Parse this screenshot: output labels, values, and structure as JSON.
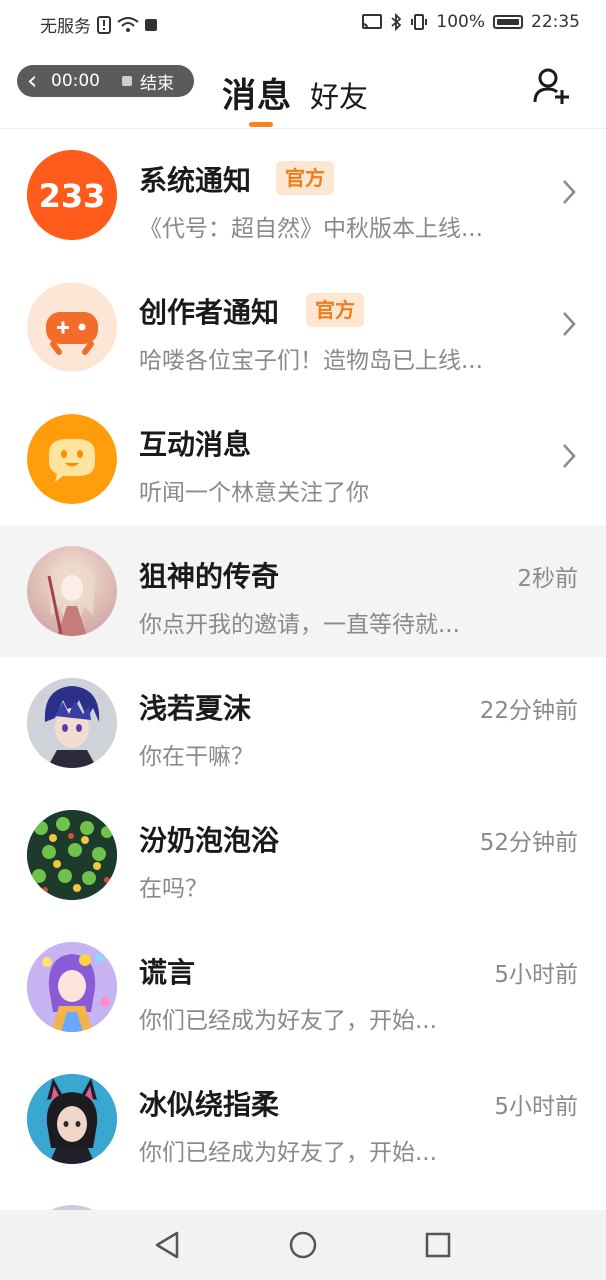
{
  "status_bar": {
    "carrier": "无服务",
    "battery": "100%",
    "time": "22:35"
  },
  "recorder": {
    "time": "00:00",
    "end_label": "结束"
  },
  "header": {
    "tabs": [
      {
        "label": "消息",
        "active": true
      },
      {
        "label": "好友",
        "active": false
      }
    ],
    "accent_color": "#f5821f"
  },
  "notifications": [
    {
      "name": "系统通知",
      "badge": "官方",
      "preview": "《代号：超自然》中秋版本上线...",
      "icon": "logo-233-icon"
    },
    {
      "name": "创作者通知",
      "badge": "官方",
      "preview": "哈喽各位宝子们！造物岛已上线...",
      "icon": "gamepad-icon"
    },
    {
      "name": "互动消息",
      "badge": "",
      "preview": "听闻一个林意关注了你",
      "icon": "chat-bubble-face-icon"
    }
  ],
  "conversations": [
    {
      "name": "狙神的传奇",
      "preview": "你点开我的邀请，一直等待就...",
      "time": "2秒前"
    },
    {
      "name": "浅若夏沫",
      "preview": "你在干嘛？",
      "time": "22分钟前"
    },
    {
      "name": "汾奶泡泡浴",
      "preview": "在吗？",
      "time": "52分钟前"
    },
    {
      "name": "谎言",
      "preview": "你们已经成为好友了，开始...",
      "time": "5小时前"
    },
    {
      "name": "冰似绕指柔",
      "preview": "你们已经成为好友了，开始...",
      "time": "5小时前"
    }
  ]
}
